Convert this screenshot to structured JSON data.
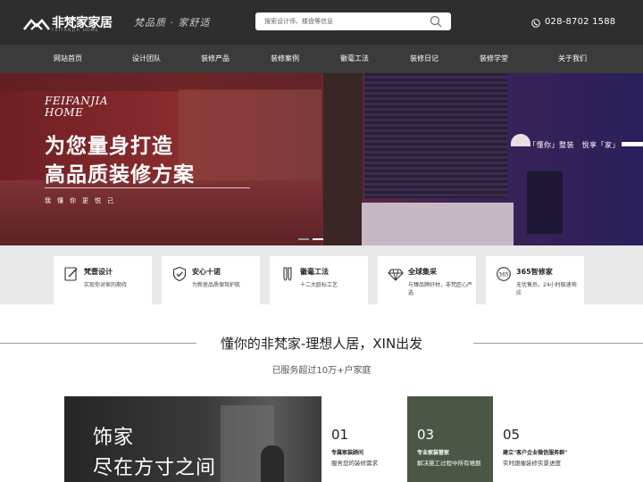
{
  "header": {
    "logo_name": "非梵家家居",
    "logo_sub": "FEIFANJIA HOME",
    "slogan": "梵品质 · 家舒适",
    "search_placeholder": "搜索设计师、楼盘等信息",
    "phone": "028-8702 1588"
  },
  "nav": {
    "items": [
      {
        "label": "网站首页"
      },
      {
        "label": "设计团队"
      },
      {
        "label": "装修产品"
      },
      {
        "label": "装修案例"
      },
      {
        "label": "徽毫工法"
      },
      {
        "label": "装修日记"
      },
      {
        "label": "装修学堂"
      },
      {
        "label": "关于我们"
      }
    ]
  },
  "hero": {
    "brand_line1": "FEIFANJIA",
    "brand_line2": "HOME",
    "headline1": "为您量身打造",
    "headline2": "高品质装修方案",
    "tagline": "我懂你更悦己",
    "side_tag": "「懂你」整装　悦享「家」"
  },
  "features": [
    {
      "title": "梵壹设计",
      "desc": "实现你对家的期待",
      "icon": "pen-paper-icon"
    },
    {
      "title": "安心十诺",
      "desc": "为新居品质保驾护航",
      "icon": "shield-check-icon"
    },
    {
      "title": "徽毫工法",
      "desc": "十二大欧标工艺",
      "icon": "brush-icon"
    },
    {
      "title": "全球集采",
      "desc": "与臻品牌好材，非梵匠心严选",
      "icon": "diamond-icon"
    },
    {
      "title": "365智修家",
      "desc": "无忧售后，24小时极速响应",
      "icon": "service-365-icon"
    }
  ],
  "section": {
    "title": "懂你的非梵家-理想人居，XIN出发",
    "subtitle": "已服务超过10万+户家庭"
  },
  "banner": {
    "line1": "饰家",
    "line2": "尽在方寸之间"
  },
  "steps": [
    {
      "num": "01",
      "title": "专属家装顾问",
      "desc": "服务您的装修需求"
    },
    {
      "num": "03",
      "title": "专业家装管家",
      "desc": "解决施工过程中所有难题"
    },
    {
      "num": "05",
      "title": "建立\"客户企业微信服务群\"",
      "desc": "实时跟催装修实景进度"
    }
  ],
  "colors": {
    "header_bg": "#2e2e2e",
    "nav_bg": "#3b3b3b",
    "step_accent": "#4b5645"
  }
}
